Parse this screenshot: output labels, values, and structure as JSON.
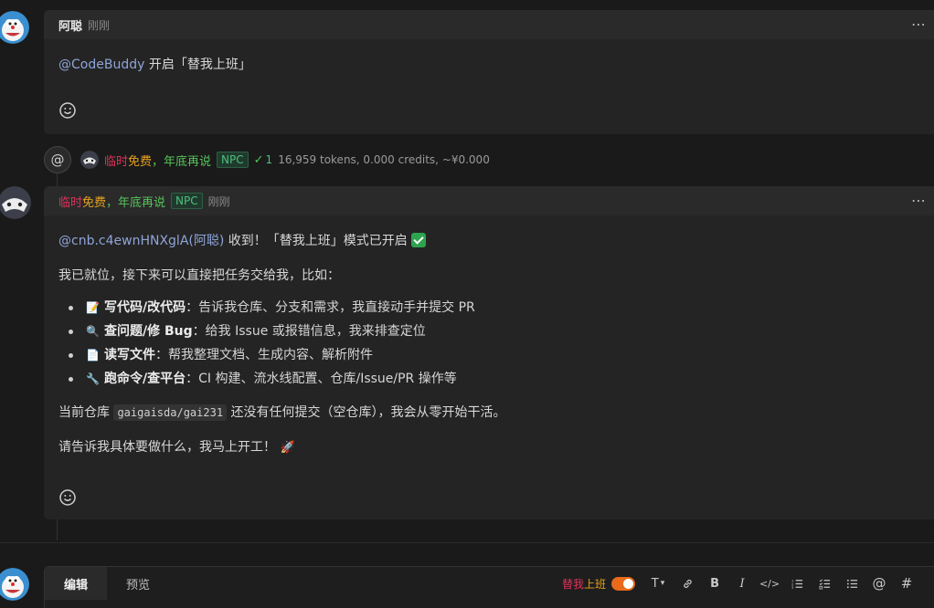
{
  "message1": {
    "author": "阿聪",
    "time": "刚刚",
    "mention": "@CodeBuddy",
    "text": " 开启「替我上班」"
  },
  "meta": {
    "bot_name_part1": "临时",
    "bot_name_part2": "免费",
    "bot_name_part3": "，年底再说",
    "npc_badge": "NPC",
    "check_count": "1",
    "stats": "16,959 tokens, 0.000 credits, ~¥0.000"
  },
  "message2": {
    "author_part1": "临时",
    "author_part2": "免费",
    "author_part3": "，年底再说",
    "npc_badge": "NPC",
    "time": "刚刚",
    "mention": "@cnb.c4ewnHNXglA(阿聪)",
    "line1": " 收到！「替我上班」模式已开启 ",
    "line2": "我已就位，接下来可以直接把任务交给我，比如：",
    "items": [
      {
        "title": "写代码/改代码",
        "text": "：告诉我仓库、分支和需求，我直接动手并提交 PR",
        "icon": "memo-icon"
      },
      {
        "title": "查问题/修 Bug",
        "text": "：给我 Issue 或报错信息，我来排查定位",
        "icon": "magnifier-icon"
      },
      {
        "title": "读写文件",
        "text": "：帮我整理文档、生成内容、解析附件",
        "icon": "document-icon"
      },
      {
        "title": "跑命令/查平台",
        "text": "：CI 构建、流水线配置、仓库/Issue/PR 操作等",
        "icon": "wrench-icon"
      }
    ],
    "repo_prefix": "当前仓库 ",
    "repo_code": "gaigaisda/gai231",
    "repo_suffix": " 还没有任何提交（空仓库），我会从零开始干活。",
    "closing": "请告诉我具体要做什么，我马上开工！"
  },
  "editor": {
    "tab_edit": "编辑",
    "tab_preview": "预览",
    "toggle_label_part1": "替我",
    "toggle_label_part2": "上班"
  },
  "colors": {
    "accent_red": "#e0325a",
    "accent_orange": "#e8a21b",
    "accent_green": "#55c35a",
    "mention": "#8fa4d8",
    "toggle": "#e86a1a"
  }
}
